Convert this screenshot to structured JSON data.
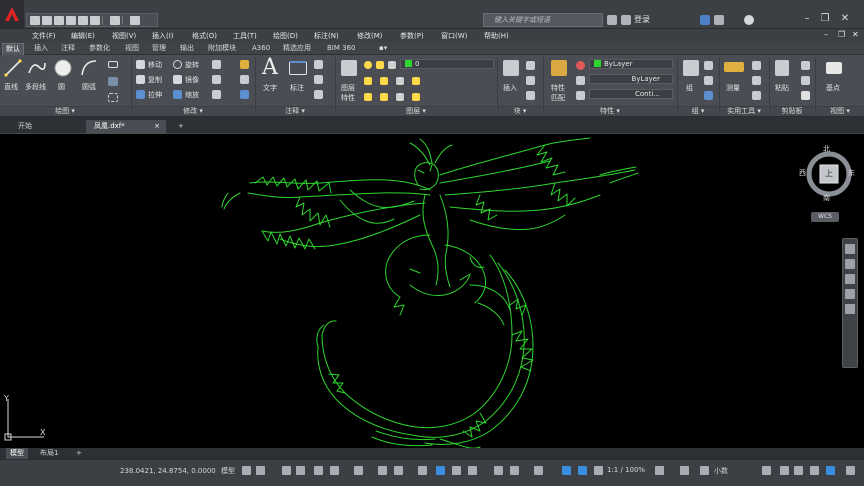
{
  "titlebar": {
    "search_placeholder": "键入关键字或短语",
    "login": "登录",
    "help": "?"
  },
  "menu": [
    "文件(F)",
    "编辑(E)",
    "视图(V)",
    "插入(I)",
    "格式(O)",
    "工具(T)",
    "绘图(D)",
    "标注(N)",
    "修改(M)",
    "参数(P)",
    "窗口(W)",
    "帮助(H)"
  ],
  "ribbon_tabs": [
    "默认",
    "插入",
    "注释",
    "参数化",
    "视图",
    "管理",
    "输出",
    "附加模块",
    "A360",
    "精选应用",
    "BIM 360"
  ],
  "ribbon": {
    "draw": {
      "line": "直线",
      "polyline": "多段线",
      "circle": "圆",
      "arc": "圆弧",
      "panel": "绘图 ▾"
    },
    "modify": {
      "move": "移动",
      "rotate": "旋转",
      "copy": "复制",
      "mirror": "镜像",
      "stretch": "拉伸",
      "scale": "缩放",
      "panel": "修改 ▾"
    },
    "annotation": {
      "text": "文字",
      "dimension": "标注",
      "panel": "注释 ▾"
    },
    "layers": {
      "properties": "图层特性",
      "current_layer": "0",
      "panel": "图层 ▾"
    },
    "block": {
      "insert": "插入",
      "panel": "块 ▾"
    },
    "properties": {
      "match": "特性匹配",
      "color": "ByLayer",
      "lineweight": "ByLayer",
      "linetype": "Conti...",
      "panel": "特性 ▾"
    },
    "groups": {
      "group": "组",
      "panel": "组 ▾"
    },
    "utilities": {
      "measure": "测量",
      "panel": "实用工具 ▾"
    },
    "clipboard": {
      "paste": "粘贴",
      "panel": "剪贴板"
    },
    "view": {
      "base": "基点",
      "panel": "视图 ▾"
    }
  },
  "file_tabs": [
    "开始",
    "凤凰.dxf*"
  ],
  "add_tab": "+",
  "viewcube": {
    "north": "北",
    "south": "南",
    "east": "东",
    "west": "西",
    "face": "上",
    "wcs": "WCS"
  },
  "ucs": {
    "x": "X",
    "y": "Y"
  },
  "layout_tabs": [
    "模型",
    "布局1"
  ],
  "status": {
    "coordinates": "238.0421, 24.8754, 0.0000",
    "model": "模型",
    "annotation_scale": "1:1 / 100%",
    "units": "小数"
  },
  "colors": {
    "drawing": "#2fd62f",
    "ribbon": "#4a4d53",
    "canvas": "#000000",
    "accent": "#3a8fe0"
  }
}
